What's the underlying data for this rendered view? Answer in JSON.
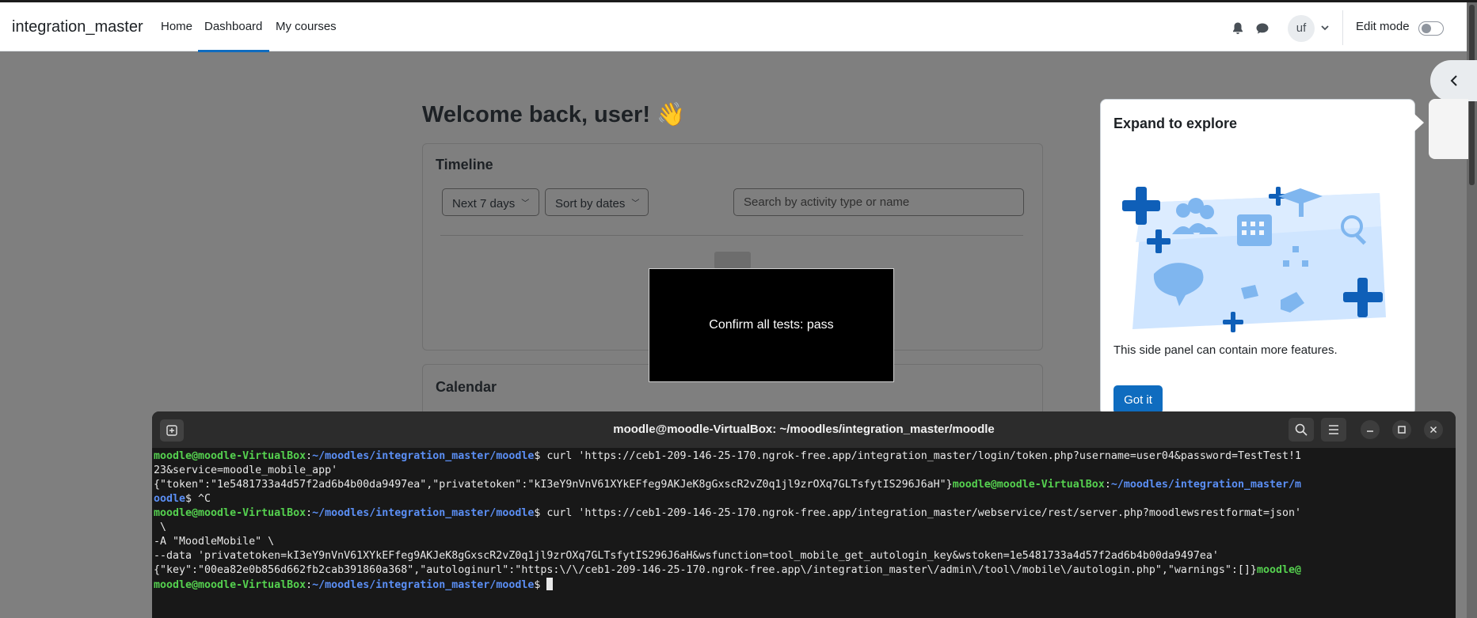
{
  "navbar": {
    "brand": "integration_master",
    "links": [
      "Home",
      "Dashboard",
      "My courses"
    ],
    "active_link": "Dashboard",
    "user_initials": "uf",
    "edit_mode_label": "Edit mode",
    "edit_mode_on": false
  },
  "dashboard": {
    "welcome": "Welcome back, user! 👋",
    "timeline": {
      "title": "Timeline",
      "filter_days": "Next 7 days",
      "sort": "Sort by dates",
      "search_placeholder": "Search by activity type or name"
    },
    "calendar": {
      "title": "Calendar"
    }
  },
  "overlay": {
    "message": "Confirm all tests: pass"
  },
  "popover": {
    "title": "Expand to explore",
    "text": "This side panel can contain more features.",
    "button": "Got it"
  },
  "terminal": {
    "title": "moodle@moodle-VirtualBox: ~/moodles/integration_master/moodle",
    "prompt_user": "moodle@moodle-VirtualBox",
    "prompt_path": "~/moodles/integration_master/moodle",
    "lines": {
      "l1_cmd": "$ curl 'https://ceb1-209-146-25-170.ngrok-free.app/integration_master/login/token.php?username=user04&password=TestTest!1",
      "l2": "23&service=moodle_mobile_app'",
      "l3_out": "{\"token\":\"1e5481733a4d57f2ad6b4b00da9497ea\",\"privatetoken\":\"kI3eY9nVnV61XYkEFfeg9AKJeK8gGxscR2vZ0q1jl9zrOXq7GLTsfytIS296J6aH\"}",
      "l3_user": "moodle@moodle-VirtualBox",
      "l3_path": "~/moodles/integration_master/m",
      "l4_path": "oodle",
      "l4_rest": "$ ^C",
      "l5_cmd": "$ curl 'https://ceb1-209-146-25-170.ngrok-free.app/integration_master/webservice/rest/server.php?moodlewsrestformat=json'",
      "l6": " \\",
      "l7": "-A \"MoodleMobile\" \\",
      "l8": "--data 'privatetoken=kI3eY9nVnV61XYkEFfeg9AKJeK8gGxscR2vZ0q1jl9zrOXq7GLTsfytIS296J6aH&wsfunction=tool_mobile_get_autologin_key&wstoken=1e5481733a4d57f2ad6b4b00da9497ea'",
      "l9_out": "{\"key\":\"00ea82e0b856d662fb2cab391860a368\",\"autologinurl\":\"https:\\/\\/ceb1-209-146-25-170.ngrok-free.app\\/integration_master\\/admin\\/tool\\/mobile\\/autologin.php\",\"warnings\":[]}",
      "l9_user": "moodle@",
      "l10_user": "moodle@moodle-VirtualBox",
      "l10_end": "$ "
    }
  }
}
